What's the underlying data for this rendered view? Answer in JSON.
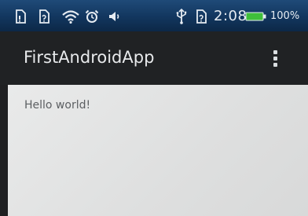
{
  "status_bar": {
    "icons": [
      "sim-card-icon",
      "sim-card-alert-icon",
      "wifi-icon",
      "alarm-icon",
      "volume-icon",
      "usb-icon",
      "sim-card-icon",
      "battery-icon"
    ],
    "time": "2:08",
    "battery_percent": "100%",
    "battery_color": "#3fbf3a"
  },
  "action_bar": {
    "title": "FirstAndroidApp",
    "overflow_icon": "more-vert-icon"
  },
  "content": {
    "text": "Hello world!"
  }
}
